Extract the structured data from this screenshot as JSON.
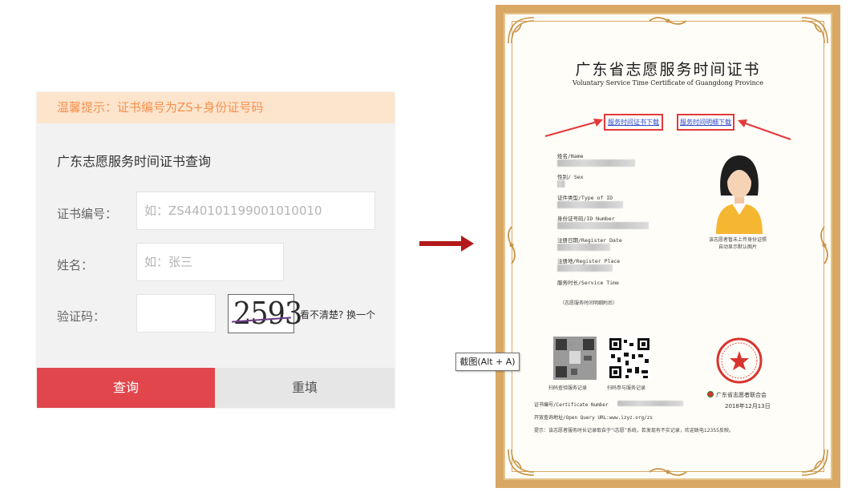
{
  "query_panel": {
    "tip": "温馨提示：证书编号为ZS+身份证号码",
    "title": "广东志愿服务时间证书查询",
    "cert_no_label": "证书编号：",
    "cert_no_placeholder": "如：ZS440101199001010010",
    "name_label": "姓名：",
    "name_placeholder": "如：张三",
    "captcha_label": "验证码：",
    "captcha_value": "",
    "captcha_text": "2593",
    "refresh_label": "看不清楚? 换一个",
    "query_button": "查询",
    "reset_button": "重填"
  },
  "screenshot_tip": "截图(Alt + A)",
  "certificate": {
    "title": "广东省志愿服务时间证书",
    "subtitle": "Voluntary Service Time Certificate of Guangdong Province",
    "download_cert": "服务时间证书下载",
    "download_detail": "服务时间明细下载",
    "fields": [
      {
        "label": "姓名/Name"
      },
      {
        "label": "性别/ Sex"
      },
      {
        "label": "证件类型/Type of ID"
      },
      {
        "label": "身份证号码/ID Number"
      },
      {
        "label": "注册日期/Register Date"
      },
      {
        "label": "注册地/Register Place"
      },
      {
        "label": "服务时长/Service Time"
      }
    ],
    "service_note": "（志愿服务时间明细附后）",
    "photo_note": "该志愿者暂未上传身份证照\n自动显示默认图片",
    "qr_left_label": "扫码查验服务记录",
    "qr_right_label": "扫码参与服务记录",
    "issuer": "广东省志愿者联合会",
    "issue_date": "2018年12月13日",
    "cert_number_label": "证书编号/Certificate Number",
    "query_url": "开放查询地址/Open Query URL:www.izyz.org/zs",
    "footer_tip": "提示：该志愿者服务时长记录取自于“i志愿”系统，若发现有不实记录，欢迎致电12355反映。"
  },
  "colors": {
    "tip_bg": "#fde4cd",
    "tip_text": "#f5924e",
    "query_button": "#e0464c",
    "arrow": "#b3191a",
    "frame_gold": "#d9a865",
    "highlight_red": "#e23a3a"
  }
}
